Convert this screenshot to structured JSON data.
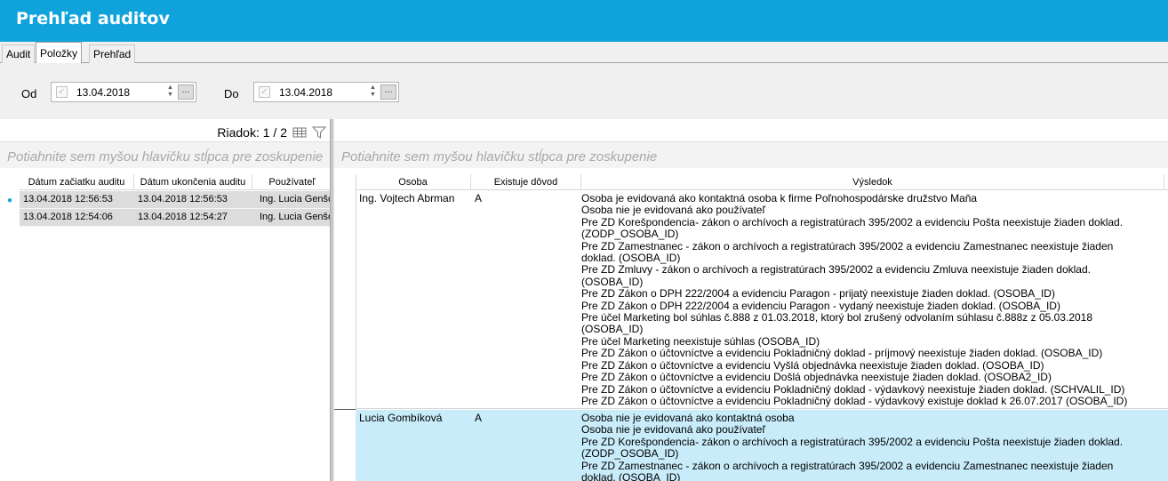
{
  "window": {
    "title": "Prehľad auditov"
  },
  "tabs": [
    "Audit",
    "Položky",
    "Prehľad"
  ],
  "active_tab": "Položky",
  "filters": {
    "from": {
      "label": "Od",
      "value": "13.04.2018"
    },
    "to": {
      "label": "Do",
      "value": "13.04.2018"
    },
    "ellipsis": "..."
  },
  "left_grid": {
    "row_counter": "Riadok: 1 / 2",
    "group_hint": "Potiahnite sem myšou hlavičku stĺpca pre zoskupenie",
    "columns": [
      "Dátum začiatku auditu",
      "Dátum ukončenia auditu",
      "Používateľ"
    ],
    "rows": [
      {
        "start": "13.04.2018 12:56:53",
        "end": "13.04.2018 12:56:53",
        "user": "Ing. Lucia Genšorová"
      },
      {
        "start": "13.04.2018 12:54:06",
        "end": "13.04.2018 12:54:27",
        "user": "Ing. Lucia Genšorová"
      }
    ]
  },
  "right_grid": {
    "group_hint": "Potiahnite sem myšou hlavičku stĺpca pre zoskupenie",
    "columns": [
      "Osoba",
      "Existuje dôvod",
      "Výsledok"
    ],
    "rows": [
      {
        "person": "Ing. Vojtech Abrman",
        "reason": "A",
        "result_lines": [
          "Osoba je evidovaná ako kontaktná osoba k firme Poľnohospodárske družstvo Maňa",
          "Osoba nie je evidovaná ako používateľ",
          "Pre ZD Korešpondencia- zákon o archívoch a registratúrach 395/2002 a evidenciu Pošta neexistuje žiaden doklad.",
          "(ZODP_OSOBA_ID)",
          "Pre ZD Zamestnanec - zákon o archívoch a registratúrach 395/2002 a evidenciu Zamestnanec neexistuje žiaden",
          "doklad. (OSOBA_ID)",
          "Pre ZD Zmluvy - zákon o archívoch a registratúrach 395/2002 a evidenciu Zmluva neexistuje žiaden doklad.",
          "(OSOBA_ID)",
          "Pre ZD Zákon o DPH 222/2004 a evidenciu Paragon - prijatý neexistuje žiaden doklad. (OSOBA_ID)",
          "Pre ZD Zákon o DPH 222/2004 a evidenciu Paragon - vydaný neexistuje žiaden doklad. (OSOBA_ID)",
          "Pre účel Marketing bol súhlas č.888 z 01.03.2018, ktorý bol zrušený odvolaním súhlasu č.888z z 05.03.2018",
          "(OSOBA_ID)",
          "Pre účel Marketing neexistuje súhlas (OSOBA_ID)",
          "Pre ZD Zákon o účtovníctve a evidenciu Pokladničný doklad - príjmový neexistuje žiaden doklad. (OSOBA_ID)",
          "Pre ZD Zákon o účtovníctve a evidenciu Vyšlá objednávka neexistuje žiaden doklad. (OSOBA_ID)",
          "Pre ZD Zákon o účtovníctve a evidenciu Došlá objednávka neexistuje žiaden doklad. (OSOBA2_ID)",
          "Pre ZD Zákon o účtovníctve a evidenciu Pokladničný doklad - výdavkový neexistuje žiaden doklad. (SCHVALIL_ID)",
          "Pre ZD Zákon o účtovníctve a evidenciu Pokladničný doklad - výdavkový existuje doklad k 26.07.2017 (OSOBA_ID)"
        ]
      },
      {
        "person": "Lucia Gombíková",
        "reason": "A",
        "result_lines": [
          "Osoba nie je evidovaná ako kontaktná osoba",
          "Osoba nie je evidovaná ako používateľ",
          "Pre ZD Korešpondencia- zákon o archívoch a registratúrach 395/2002 a evidenciu Pošta neexistuje žiaden doklad.",
          "(ZODP_OSOBA_ID)",
          "Pre ZD Zamestnanec - zákon o archívoch a registratúrach 395/2002 a evidenciu Zamestnanec neexistuje žiaden",
          "doklad. (OSOBA_ID)"
        ]
      }
    ]
  },
  "colors": {
    "accent": "#10a3db",
    "selected_row": "#c8ecfa",
    "row_gray": "#dcdcdc"
  },
  "icons": [
    "grid-icon",
    "filter-icon",
    "row-indicator-icon",
    "checkbox-icon",
    "spin-updown-icon"
  ]
}
